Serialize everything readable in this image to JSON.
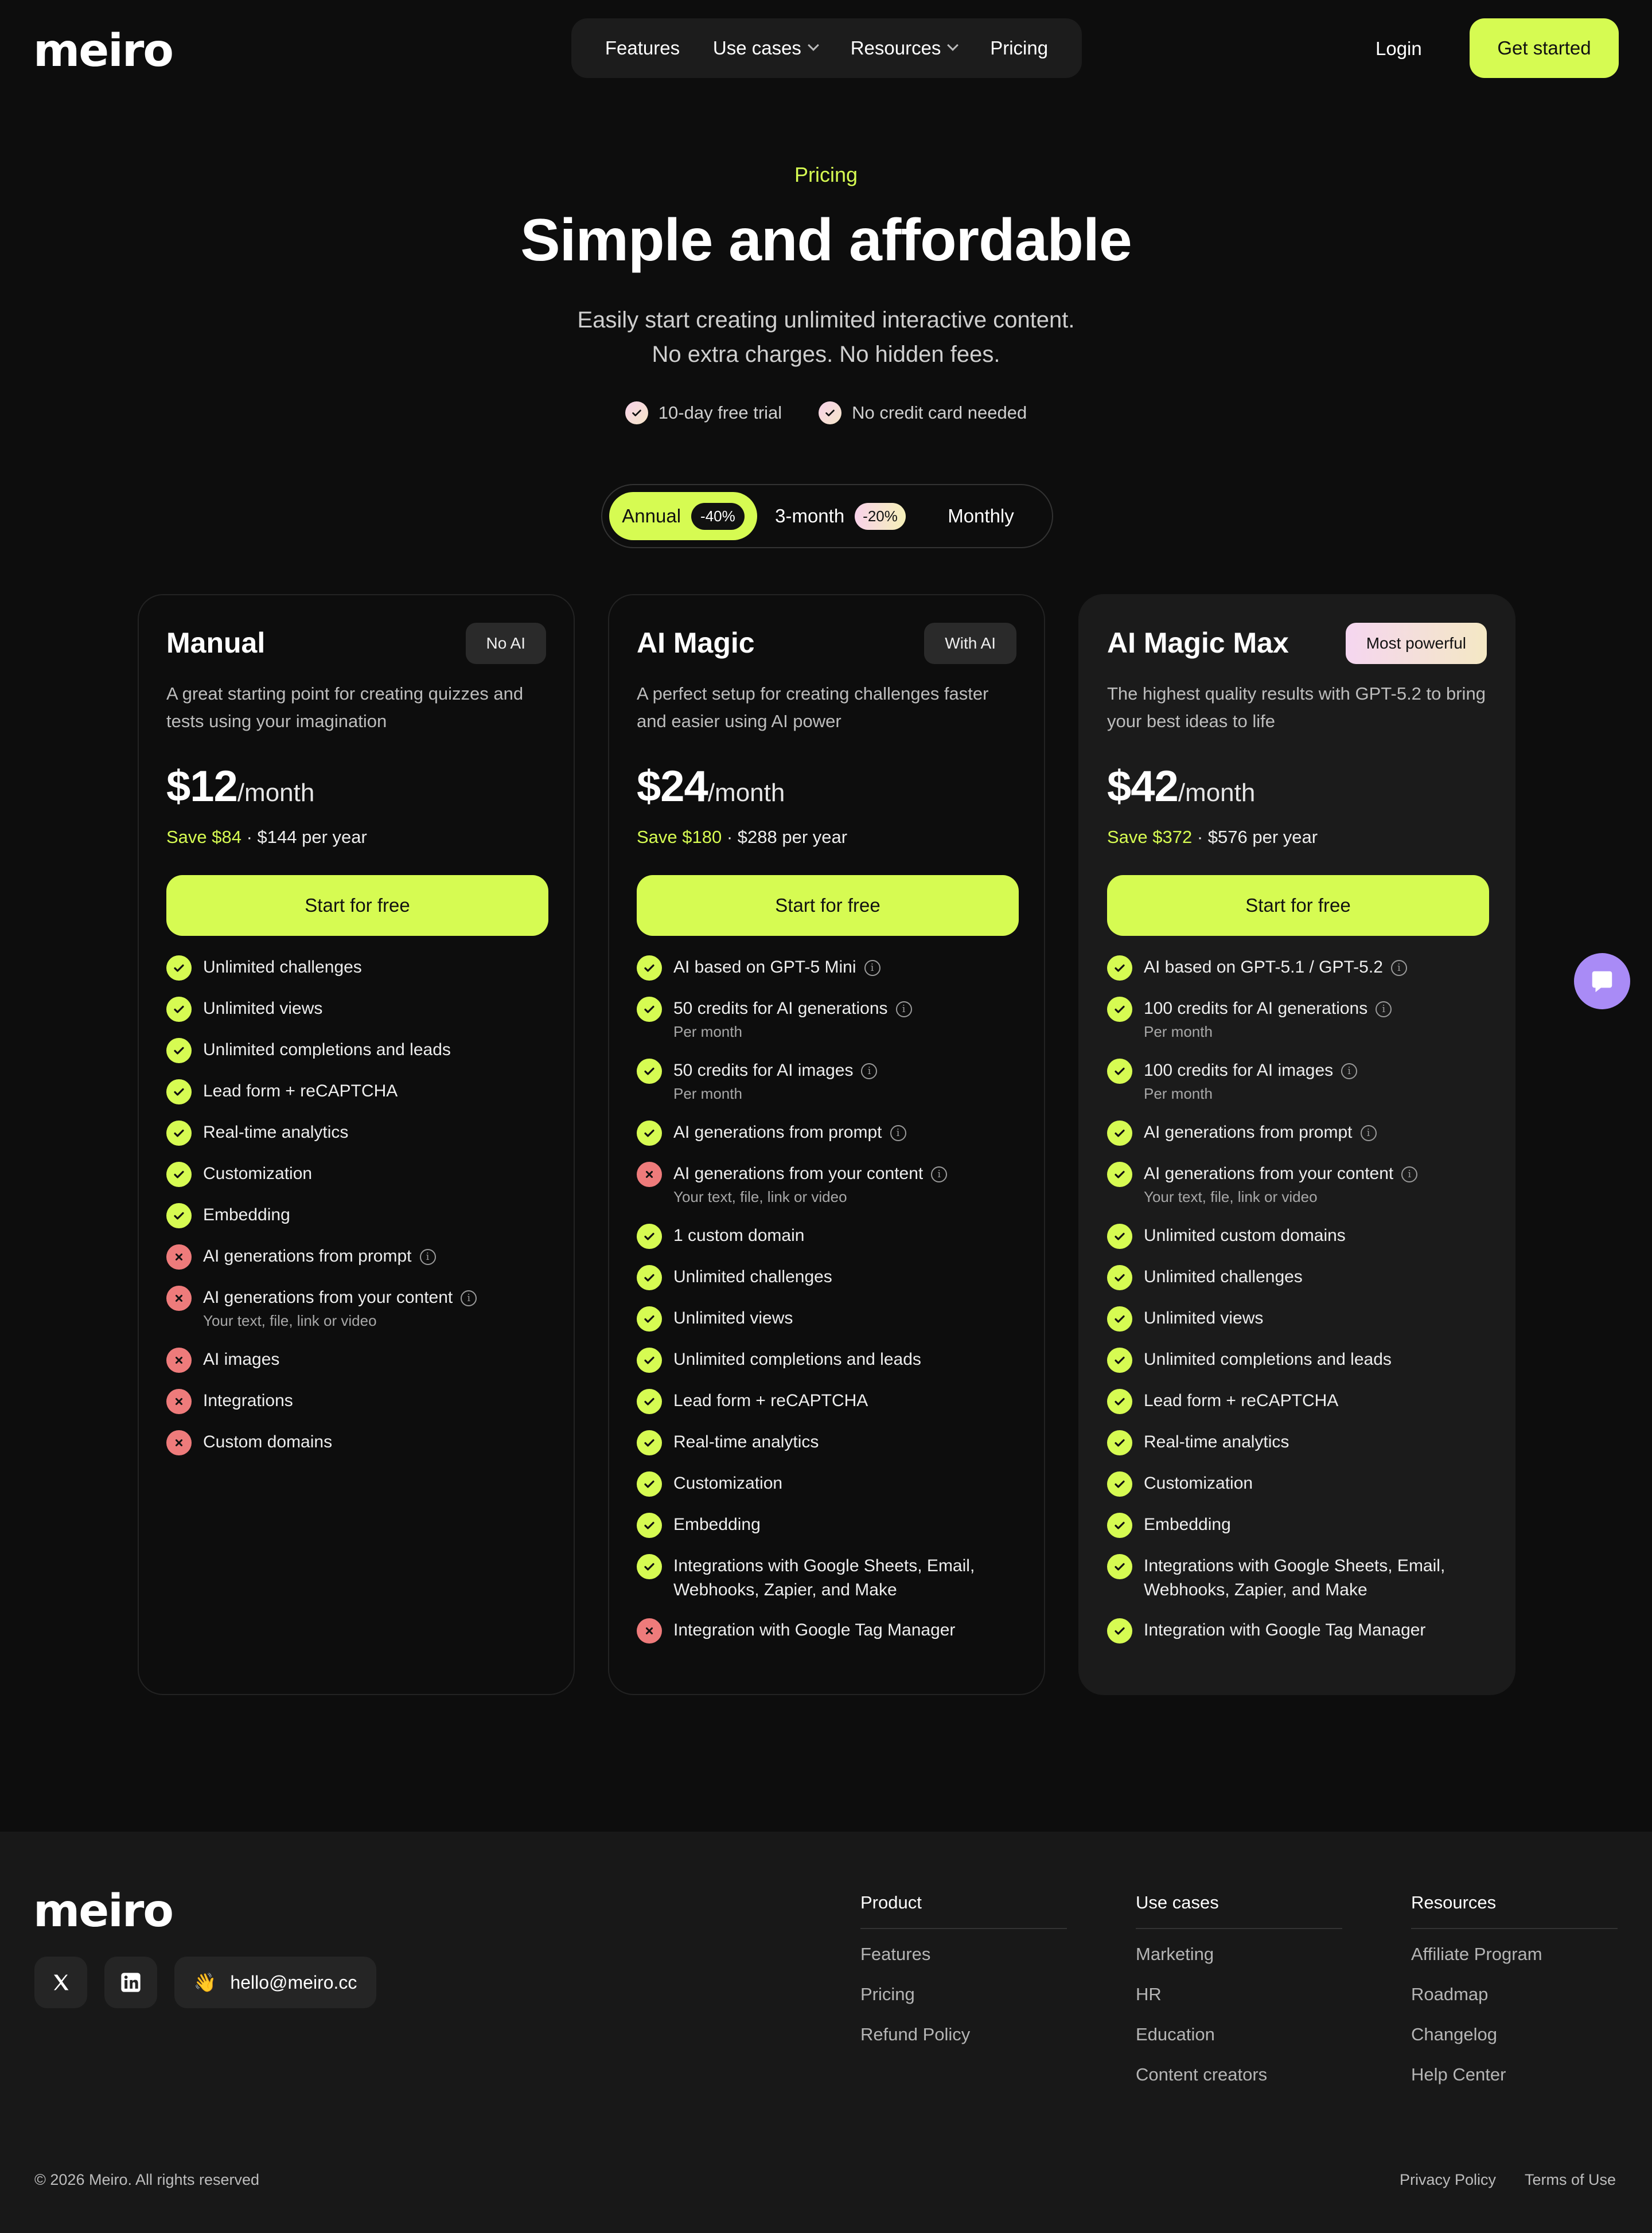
{
  "brand": {
    "logo": "meiro"
  },
  "nav": {
    "items": [
      {
        "label": "Features",
        "dropdown": false
      },
      {
        "label": "Use cases",
        "dropdown": true
      },
      {
        "label": "Resources",
        "dropdown": true
      },
      {
        "label": "Pricing",
        "dropdown": false
      }
    ],
    "login": "Login",
    "cta": "Get started"
  },
  "hero": {
    "eyebrow": "Pricing",
    "title": "Simple and affordable",
    "subtitle_line1": "Easily start creating unlimited interactive content.",
    "subtitle_line2": "No extra charges. No hidden fees.",
    "perks": [
      "10-day free trial",
      "No credit card needed"
    ]
  },
  "billing": {
    "options": [
      {
        "label": "Annual",
        "badge": "-40%",
        "active": true
      },
      {
        "label": "3-month",
        "badge": "-20%",
        "active": false
      },
      {
        "label": "Monthly",
        "badge": "",
        "active": false
      }
    ]
  },
  "plans": [
    {
      "name": "Manual",
      "tag": "No AI",
      "desc": "A great starting point for creating quizzes and tests using your imagination",
      "price": "$12",
      "per": "/month",
      "save": "Save $84",
      "yearly": " · $144 per year",
      "button": "Start for free",
      "features": [
        {
          "t": "Unlimited challenges",
          "ok": true
        },
        {
          "t": "Unlimited views",
          "ok": true
        },
        {
          "t": "Unlimited completions and leads",
          "ok": true
        },
        {
          "t": "Lead form + reCAPTCHA",
          "ok": true
        },
        {
          "t": "Real-time analytics",
          "ok": true
        },
        {
          "t": "Customization",
          "ok": true
        },
        {
          "t": "Embedding",
          "ok": true
        },
        {
          "t": "AI generations from prompt",
          "ok": false,
          "info": true
        },
        {
          "t": "AI generations from your content",
          "ok": false,
          "info": true,
          "sub": "Your text, file, link or video"
        },
        {
          "t": "AI images",
          "ok": false
        },
        {
          "t": "Integrations",
          "ok": false
        },
        {
          "t": "Custom domains",
          "ok": false
        }
      ]
    },
    {
      "name": "AI Magic",
      "tag": "With AI",
      "desc": "A perfect setup for creating challenges faster and easier using AI power",
      "price": "$24",
      "per": "/month",
      "save": "Save $180",
      "yearly": " · $288 per year",
      "button": "Start for free",
      "features": [
        {
          "t": "AI based on GPT-5 Mini",
          "ok": true,
          "info": true
        },
        {
          "t": "50 credits for AI generations",
          "ok": true,
          "info": true,
          "sub": "Per month"
        },
        {
          "t": "50 credits for AI images",
          "ok": true,
          "info": true,
          "sub": "Per month"
        },
        {
          "t": "AI generations from prompt",
          "ok": true,
          "info": true
        },
        {
          "t": "AI generations from your content",
          "ok": false,
          "info": true,
          "sub": "Your text, file, link or video"
        },
        {
          "t": "1 custom domain",
          "ok": true
        },
        {
          "t": "Unlimited challenges",
          "ok": true
        },
        {
          "t": "Unlimited views",
          "ok": true
        },
        {
          "t": "Unlimited completions and leads",
          "ok": true
        },
        {
          "t": "Lead form + reCAPTCHA",
          "ok": true
        },
        {
          "t": "Real-time analytics",
          "ok": true
        },
        {
          "t": "Customization",
          "ok": true
        },
        {
          "t": "Embedding",
          "ok": true
        },
        {
          "t": "Integrations with Google Sheets, Email, Webhooks, Zapier, and Make",
          "ok": true
        },
        {
          "t": "Integration with Google Tag Manager",
          "ok": false
        }
      ]
    },
    {
      "name": "AI Magic Max",
      "tag": "Most powerful",
      "desc": "The highest quality results with GPT-5.2 to bring your best ideas to life",
      "price": "$42",
      "per": "/month",
      "save": "Save $372",
      "yearly": " · $576 per year",
      "button": "Start for free",
      "features": [
        {
          "t": "AI based on GPT-5.1 / GPT-5.2",
          "ok": true,
          "info": true
        },
        {
          "t": "100 credits for AI generations",
          "ok": true,
          "info": true,
          "sub": "Per month"
        },
        {
          "t": "100 credits for AI images",
          "ok": true,
          "info": true,
          "sub": "Per month"
        },
        {
          "t": "AI generations from prompt",
          "ok": true,
          "info": true
        },
        {
          "t": "AI generations from your content",
          "ok": true,
          "info": true,
          "sub": "Your text, file, link or video"
        },
        {
          "t": "Unlimited custom domains",
          "ok": true
        },
        {
          "t": "Unlimited challenges",
          "ok": true
        },
        {
          "t": "Unlimited views",
          "ok": true
        },
        {
          "t": "Unlimited completions and leads",
          "ok": true
        },
        {
          "t": "Lead form + reCAPTCHA",
          "ok": true
        },
        {
          "t": "Real-time analytics",
          "ok": true
        },
        {
          "t": "Customization",
          "ok": true
        },
        {
          "t": "Embedding",
          "ok": true
        },
        {
          "t": "Integrations with Google Sheets, Email, Webhooks, Zapier, and Make",
          "ok": true
        },
        {
          "t": "Integration with Google Tag Manager",
          "ok": true
        }
      ]
    }
  ],
  "footer": {
    "logo": "meiro",
    "email": "hello@meiro.cc",
    "email_emoji": "👋",
    "columns": [
      {
        "title": "Product",
        "links": [
          "Features",
          "Pricing",
          "Refund Policy"
        ]
      },
      {
        "title": "Use cases",
        "links": [
          "Marketing",
          "HR",
          "Education",
          "Content creators"
        ]
      },
      {
        "title": "Resources",
        "links": [
          "Affiliate Program",
          "Roadmap",
          "Changelog",
          "Help Center"
        ]
      }
    ],
    "copyright": "© 2026 Meiro. All rights reserved",
    "privacy": "Privacy Policy",
    "terms": "Terms of Use"
  },
  "colors": {
    "accent": "#d6fb52",
    "bg": "#0d0d0d",
    "card_max_bg": "#1b1b1b",
    "no": "#ee7b7b",
    "chat": "#a98bf6"
  },
  "icons": {
    "check": "check-icon",
    "cross": "x-icon",
    "info": "info-icon",
    "chevron": "chevron-down-icon",
    "chat": "chat-icon",
    "x_social": "x-logo-icon",
    "linkedin": "linkedin-icon"
  }
}
